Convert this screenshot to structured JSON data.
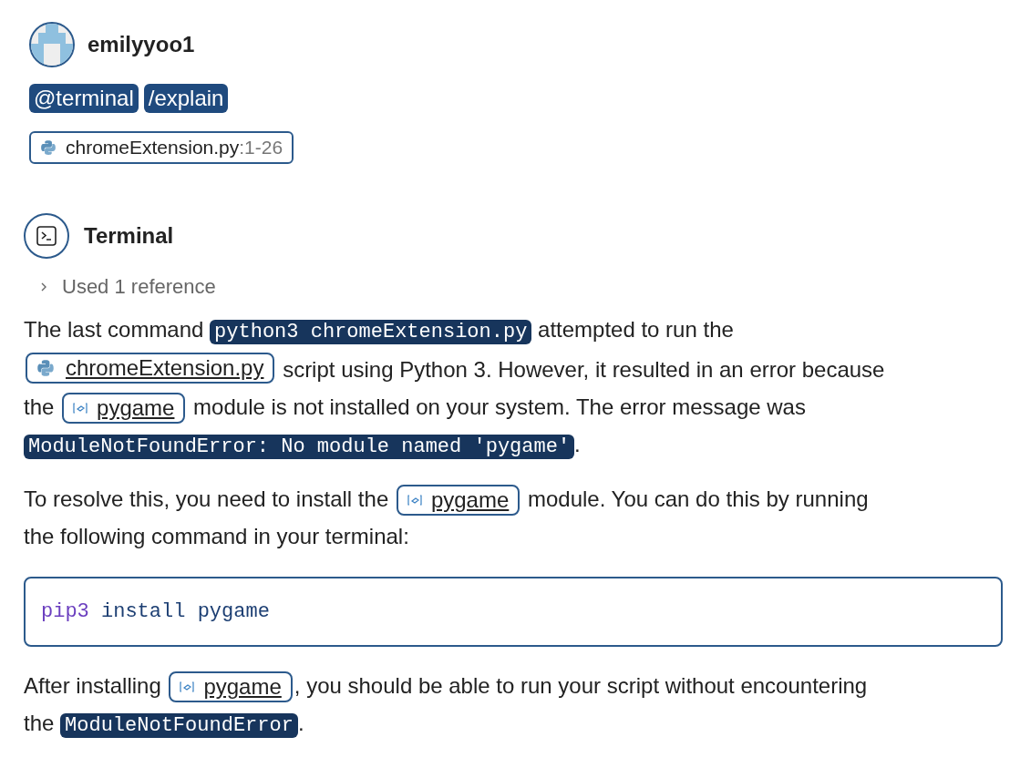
{
  "user": {
    "name": "emilyyoo1"
  },
  "commands": [
    "@terminal",
    "/explain"
  ],
  "attachment": {
    "file": "chromeExtension.py",
    "range": ":1-26"
  },
  "response": {
    "agent": "Terminal",
    "references": {
      "label": "Used 1 reference",
      "expanded": false
    },
    "blocks": [
      {
        "kind": "paragraph",
        "lines": [
          [
            {
              "kind": "text",
              "text": "The last command"
            },
            {
              "kind": "code",
              "text": "python3 chromeExtension.py"
            },
            {
              "kind": "text",
              "text": "attempted to run the"
            }
          ],
          [
            {
              "kind": "file",
              "text": "chromeExtension.py"
            },
            {
              "kind": "text",
              "text": "script using Python 3. However, it resulted in an error because"
            }
          ],
          [
            {
              "kind": "text",
              "text": "the"
            },
            {
              "kind": "symbol",
              "text": "pygame"
            },
            {
              "kind": "text",
              "text": "module is not installed on your system. The error message was"
            }
          ],
          [
            {
              "kind": "code",
              "text": "ModuleNotFoundError: No module named 'pygame'"
            },
            {
              "kind": "text",
              "text": "."
            }
          ]
        ]
      },
      {
        "kind": "paragraph",
        "lines": [
          [
            {
              "kind": "text",
              "text": "To resolve this, you need to install the"
            },
            {
              "kind": "symbol",
              "text": "pygame"
            },
            {
              "kind": "text",
              "text": "module. You can do this by running"
            }
          ],
          [
            {
              "kind": "text",
              "text": "the following command in your terminal:"
            }
          ]
        ]
      },
      {
        "kind": "codeblock",
        "command": "pip3",
        "args": "install pygame"
      },
      {
        "kind": "paragraph",
        "lines": [
          [
            {
              "kind": "text",
              "text": "After installing"
            },
            {
              "kind": "symbol",
              "text": "pygame"
            },
            {
              "kind": "text",
              "text": ", you should be able to run your script without encountering"
            }
          ],
          [
            {
              "kind": "text",
              "text": "the"
            },
            {
              "kind": "code",
              "text": "ModuleNotFoundError"
            },
            {
              "kind": "text",
              "text": "."
            }
          ]
        ]
      }
    ]
  }
}
